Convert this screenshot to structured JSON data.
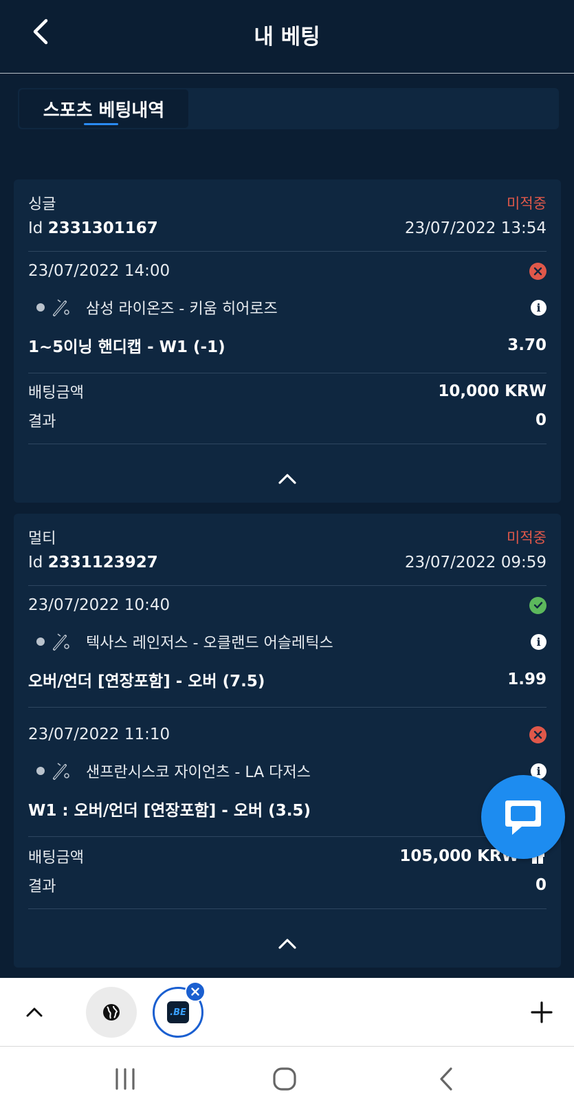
{
  "header": {
    "title": "내 베팅"
  },
  "tabs": [
    {
      "label": "스포츠 베팅내역"
    }
  ],
  "colors": {
    "background": "#0b1e33",
    "card": "#0f2740",
    "status_red": "#e0584a",
    "status_green": "#5cb85c",
    "accent_blue": "#1d8cf0"
  },
  "bets": [
    {
      "type": "싱글",
      "status": "미적중",
      "id_prefix": "Id",
      "id": "2331301167",
      "placed": "23/07/2022 13:54",
      "events": [
        {
          "datetime": "23/07/2022 14:00",
          "result_icon": "lost-icon",
          "sport_icon": "baseball-icon",
          "teams": "삼성 라이온즈 - 키움 히어로즈",
          "market": "1~5이닝 핸디캡 - W1 (-1)",
          "odds": "3.70"
        }
      ],
      "stake_label": "배팅금액",
      "stake": "10,000 KRW",
      "result_label": "결과",
      "result": "0"
    },
    {
      "type": "멀티",
      "status": "미적중",
      "id_prefix": "Id",
      "id": "2331123927",
      "placed": "23/07/2022 09:59",
      "events": [
        {
          "datetime": "23/07/2022 10:40",
          "result_icon": "won-icon",
          "sport_icon": "baseball-icon",
          "teams": "텍사스 레인저스 - 오클랜드 어슬레틱스",
          "market": "오버/언더 [연장포함] - 오버 (7.5)",
          "odds": "1.99"
        },
        {
          "datetime": "23/07/2022 11:10",
          "result_icon": "lost-icon",
          "sport_icon": "baseball-icon",
          "teams": "샌프란시스코 자이언츠 - LA 다저스",
          "market": "W1 : 오버/언더 [연장포함] - 오버 (3.5)",
          "odds": ""
        }
      ],
      "stake_label": "배팅금액",
      "stake": "105,000 KRW",
      "result_label": "결과",
      "result": "0"
    }
  ],
  "browser_bar": {
    "tab_logo": ".BE"
  }
}
